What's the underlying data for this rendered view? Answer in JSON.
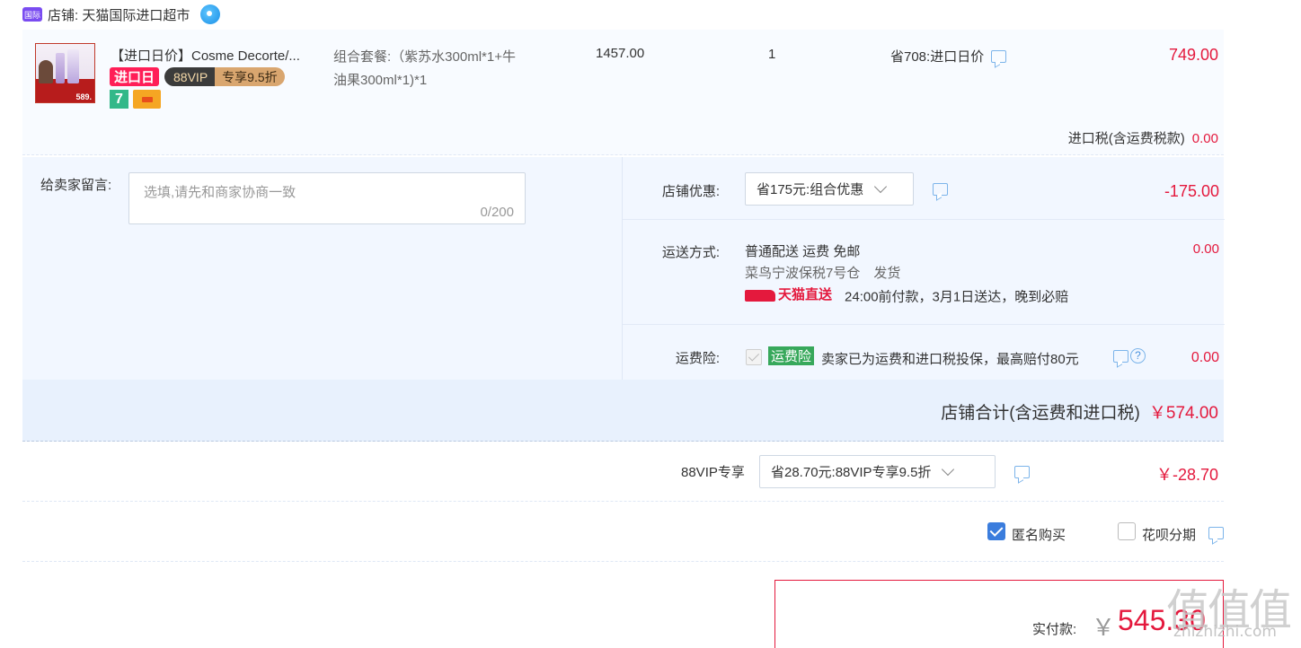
{
  "store": {
    "badge": "国际",
    "name": "店铺: 天猫国际进口超市"
  },
  "item": {
    "thumb_price": "589.",
    "title": "【进口日价】Cosme Decorte/...",
    "tag_import_day": "进口日",
    "tag_vip_left": "88VIP",
    "tag_vip_right": "专享9.5折",
    "tag_seven": "7",
    "sku_lines": [
      "组合套餐:（紫苏水300ml*1+牛",
      "油果300ml*1)*1"
    ],
    "unit_price": "1457.00",
    "quantity": "1",
    "discount_note": "省708:进口日价",
    "total": "749.00",
    "tax_label": "进口税(含运费税款)",
    "tax_value": "0.00"
  },
  "message": {
    "label": "给卖家留言:",
    "placeholder": "选填,请先和商家协商一致",
    "counter": "0/200"
  },
  "store_promo": {
    "label": "店铺优惠:",
    "selected": "省175元:组合优惠",
    "value": "-175.00"
  },
  "shipping": {
    "label": "运送方式:",
    "line1": "普通配送 运费 免邮",
    "line2": "菜鸟宁波保税7号仓　发货",
    "brand": "天猫直送",
    "promise": "24:00前付款，3月1日送达，晚到必赔",
    "value": "0.00"
  },
  "insurance": {
    "label": "运费险:",
    "tag": "运费险",
    "desc": "卖家已为运费和进口税投保，最高赔付80元",
    "help": "?",
    "value": "0.00"
  },
  "store_total": {
    "label": "店铺合计(含运费和进口税)",
    "amount": "￥574.00"
  },
  "vip": {
    "label": "88VIP专享",
    "selected": "省28.70元:88VIP专享9.5折",
    "amount": "￥-28.70"
  },
  "options": {
    "anonymous": "匿名购买",
    "anonymous_checked": true,
    "huabei": "花呗分期",
    "huabei_checked": false
  },
  "payment": {
    "label": "实付款:",
    "yen": "￥",
    "amount": "545.30"
  },
  "watermark": {
    "big": "值值值",
    "small": "zhizhizhi.com"
  },
  "colors": {
    "price_red": "#e4193d",
    "accent_blue": "#3b7ddd",
    "panel_bg": "#f2f7ff"
  }
}
